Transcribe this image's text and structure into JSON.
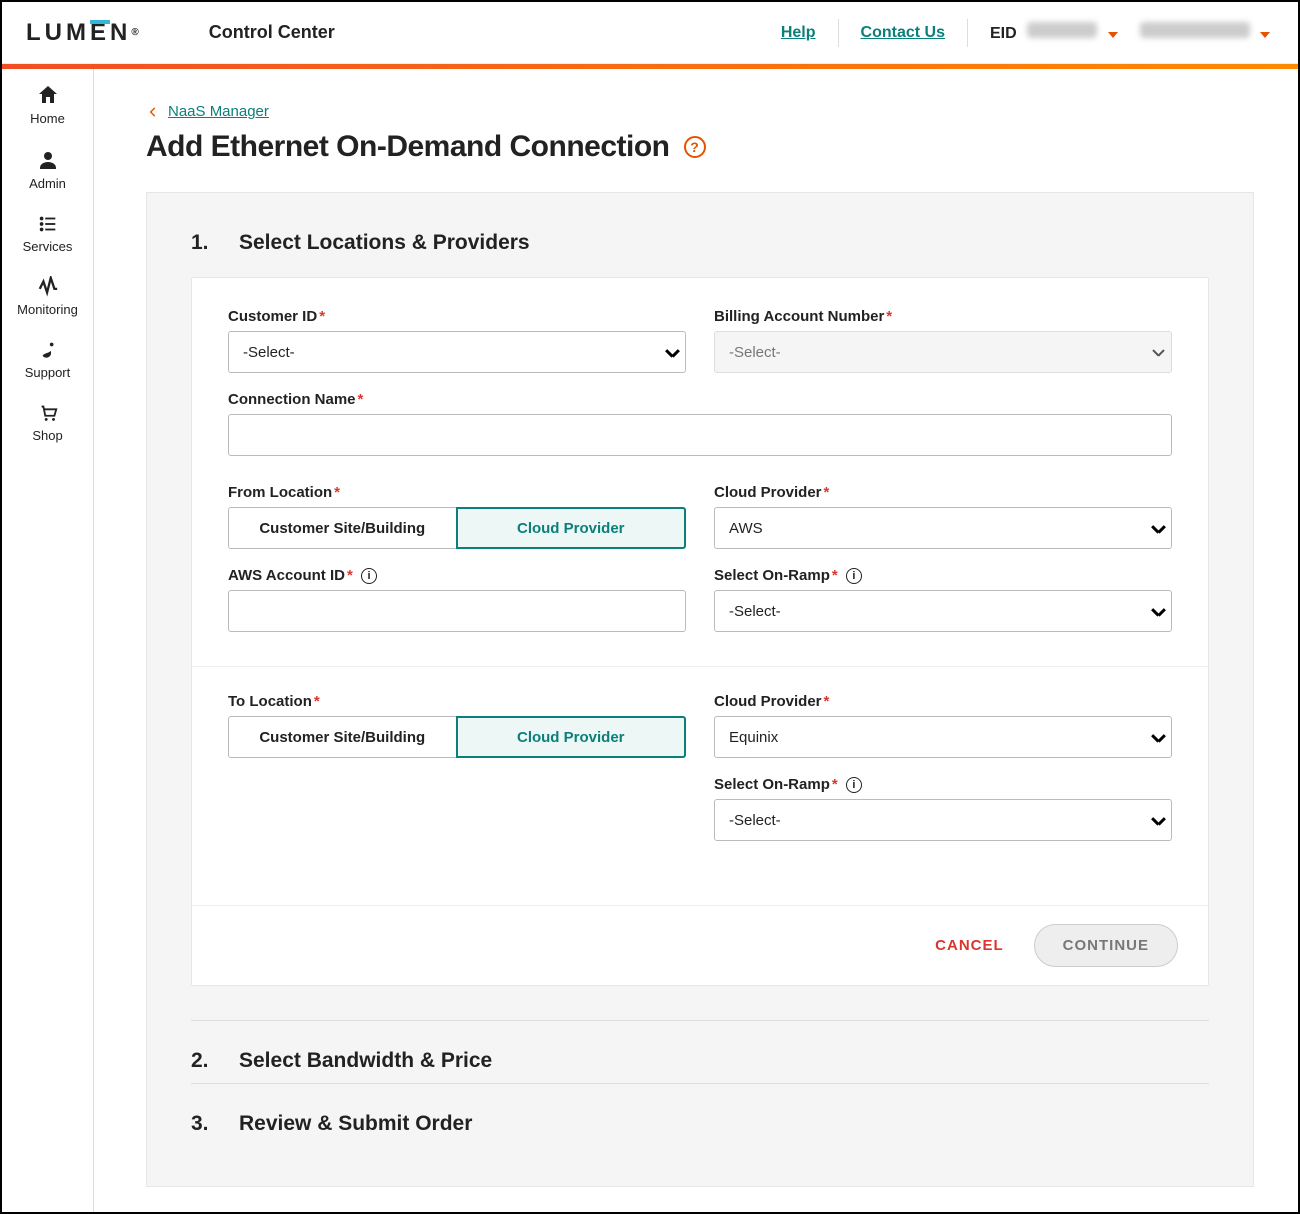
{
  "header": {
    "brand_parts": [
      "LUM",
      "E",
      "N"
    ],
    "app_title": "Control Center",
    "help_label": "Help",
    "contact_label": "Contact Us",
    "eid_label": "EID"
  },
  "sidebar": {
    "items": [
      {
        "label": "Home"
      },
      {
        "label": "Admin"
      },
      {
        "label": "Services"
      },
      {
        "label": "Monitoring"
      },
      {
        "label": "Support"
      },
      {
        "label": "Shop"
      }
    ]
  },
  "breadcrumb": {
    "label": "NaaS Manager"
  },
  "page_title": "Add Ethernet On-Demand Connection",
  "steps": {
    "s1": {
      "num": "1.",
      "title": "Select Locations & Providers"
    },
    "s2": {
      "num": "2.",
      "title": "Select Bandwidth & Price"
    },
    "s3": {
      "num": "3.",
      "title": "Review & Submit Order"
    }
  },
  "form": {
    "customer_id": {
      "label": "Customer ID",
      "value": "-Select-"
    },
    "billing": {
      "label": "Billing Account Number",
      "value": "-Select-"
    },
    "conn_name": {
      "label": "Connection Name",
      "value": ""
    },
    "from_location": {
      "label": "From Location",
      "opt_site": "Customer Site/Building",
      "opt_cloud": "Cloud Provider"
    },
    "from_cloud_provider": {
      "label": "Cloud Provider",
      "value": "AWS"
    },
    "aws_account": {
      "label": "AWS Account ID",
      "value": ""
    },
    "from_onramp": {
      "label": "Select On-Ramp",
      "value": "-Select-"
    },
    "to_location": {
      "label": "To Location",
      "opt_site": "Customer Site/Building",
      "opt_cloud": "Cloud Provider"
    },
    "to_cloud_provider": {
      "label": "Cloud Provider",
      "value": "Equinix"
    },
    "to_onramp": {
      "label": "Select On-Ramp",
      "value": "-Select-"
    }
  },
  "actions": {
    "cancel": "CANCEL",
    "continue": "CONTINUE"
  }
}
